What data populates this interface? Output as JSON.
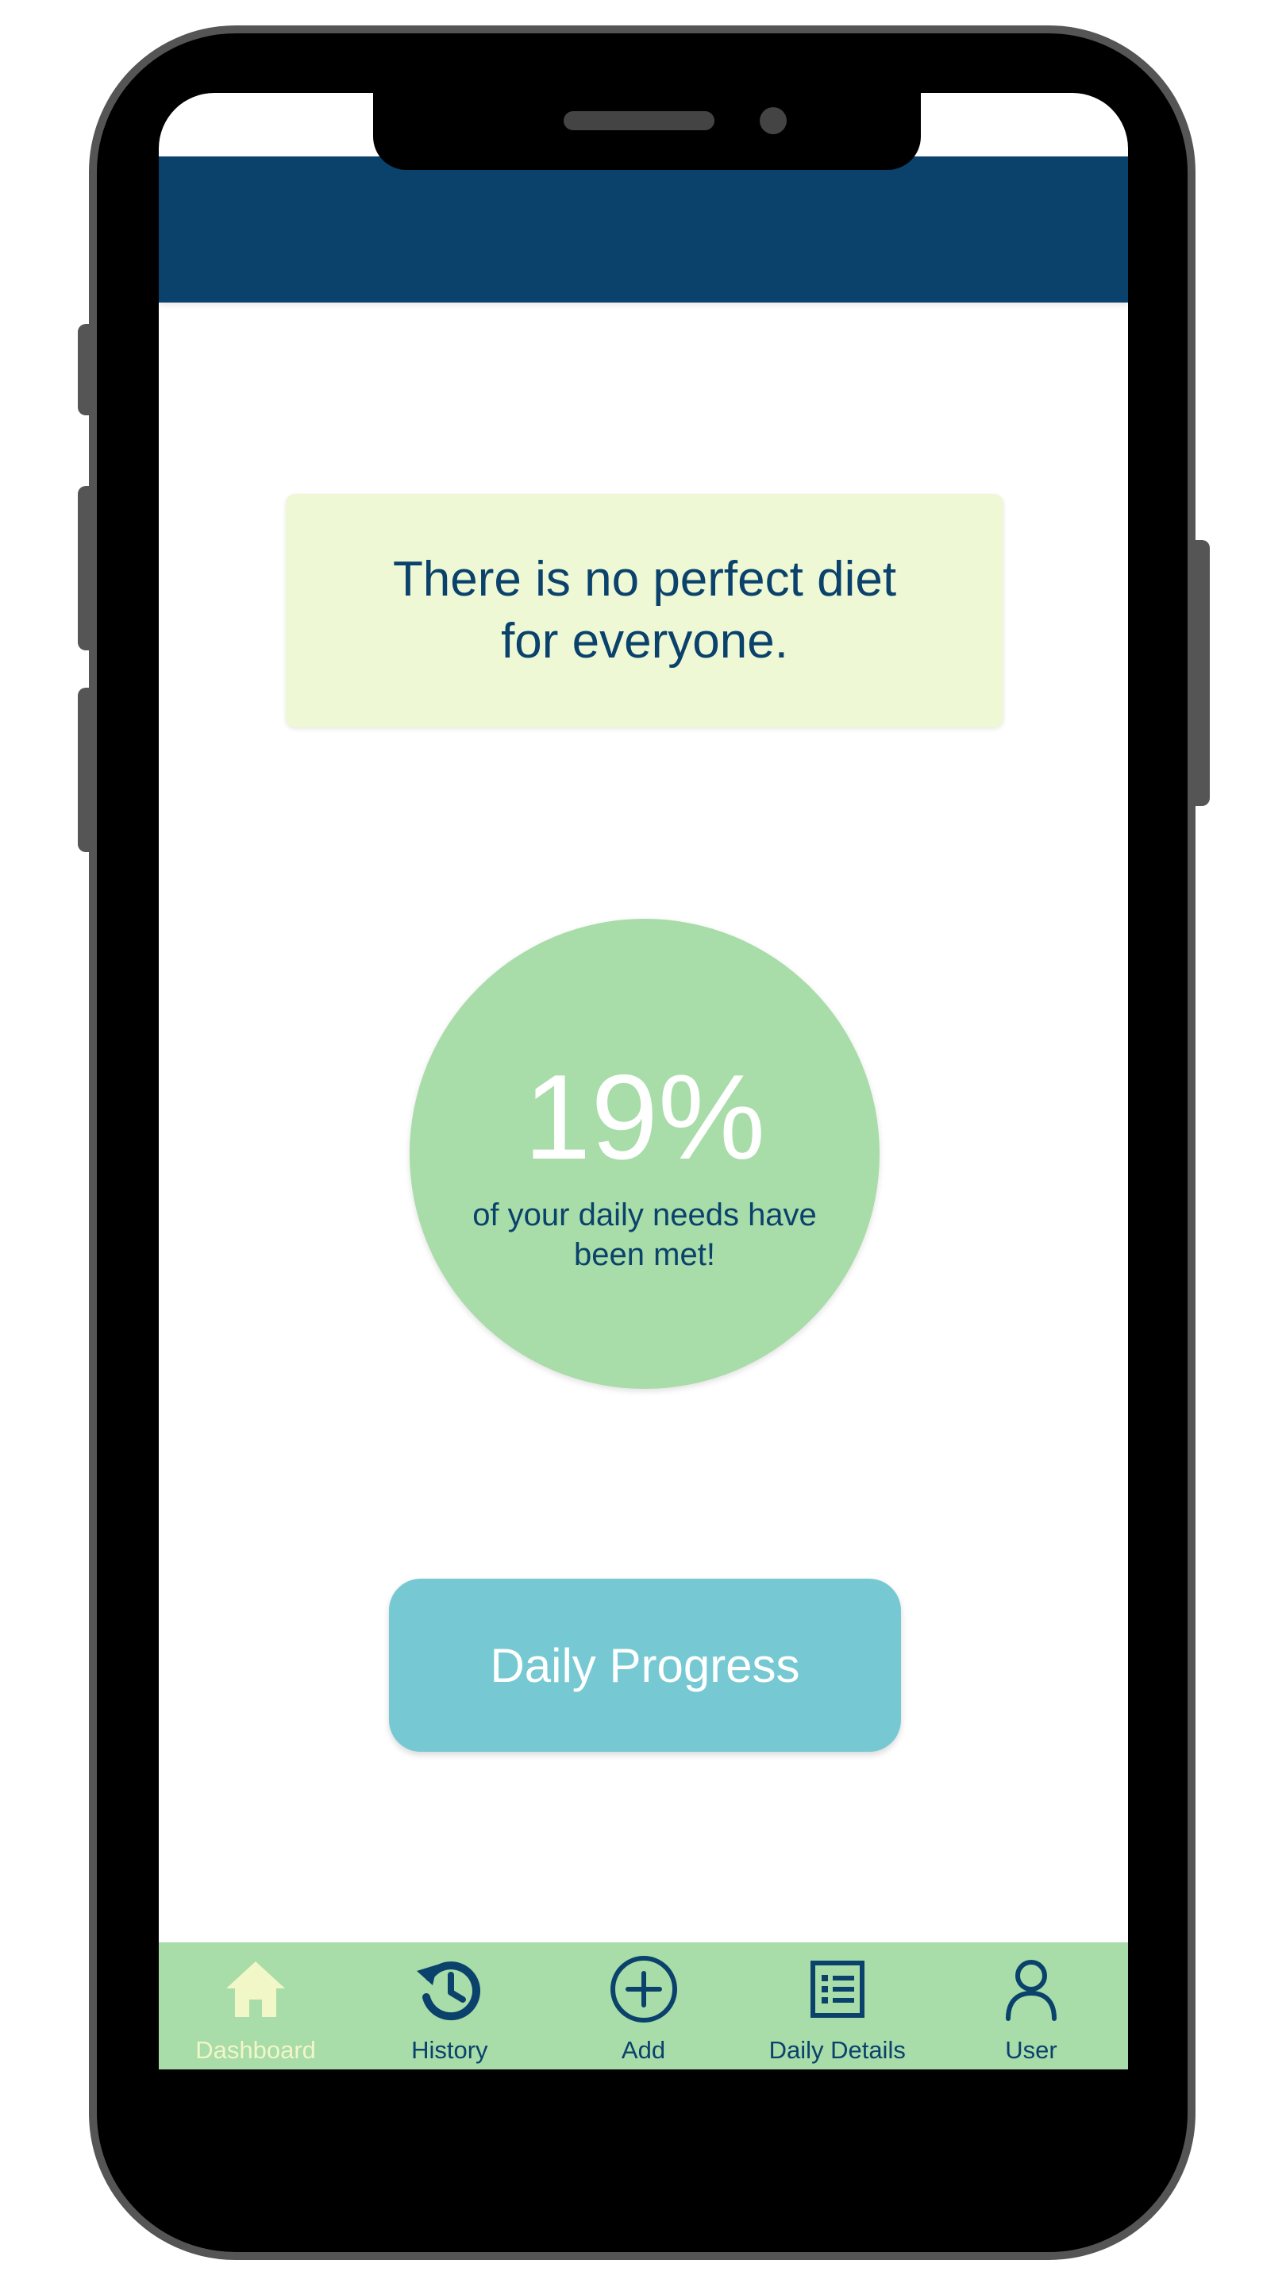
{
  "quote": {
    "text": "There is no perfect diet for everyone."
  },
  "progress": {
    "value_label": "19%",
    "value": 19,
    "caption": "of your daily needs have been met!"
  },
  "daily_progress_button": {
    "label": "Daily Progress"
  },
  "nav": {
    "items": [
      {
        "label": "Dashboard",
        "icon": "home-icon",
        "active": true
      },
      {
        "label": "History",
        "icon": "history-icon",
        "active": false
      },
      {
        "label": "Add",
        "icon": "add-circle-icon",
        "active": false
      },
      {
        "label": "Daily Details",
        "icon": "list-icon",
        "active": false
      },
      {
        "label": "User",
        "icon": "user-icon",
        "active": false
      }
    ]
  },
  "colors": {
    "primary": "#0a426c",
    "quote_bg": "#eef8d5",
    "circle": "#a8dca8",
    "button": "#76c9d2",
    "nav_bg": "#a8dca8",
    "nav_active": "#f2f7c8"
  }
}
